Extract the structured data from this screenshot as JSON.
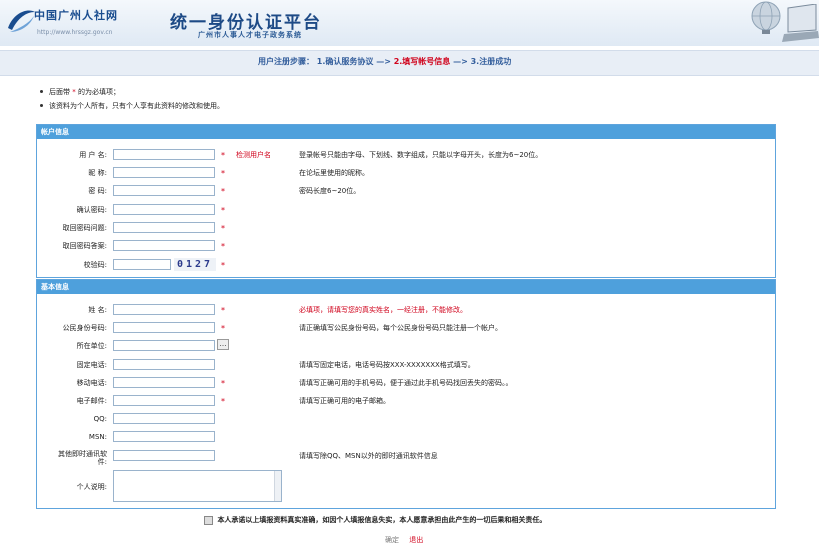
{
  "header": {
    "logo_title": "中国广州人社网",
    "logo_url": "http://www.hrssgz.gov.cn",
    "site_title": "统一身份认证平台",
    "site_subtitle": "广州市人事人才电子政务系统"
  },
  "steps": {
    "prefix": "用户注册步骤：",
    "step1": "1.确认服务协议",
    "arrow1": "—>",
    "step2": "2.填写帐号信息",
    "arrow2": "—>",
    "step3": "3.注册成功"
  },
  "notes": {
    "note1_a": "后面带",
    "note1_star": "*",
    "note1_b": "的为必填项；",
    "note2": "该资料为个人所有，只有个人享有此资料的修改和使用。"
  },
  "account": {
    "title": "帐户信息",
    "username_label": "用 户 名:",
    "check_username": "检测用户名",
    "username_hint": "登录帐号只能由字母、下划线、数字组成，只能以字母开头，长度为6~20位。",
    "nickname_label": "昵    称:",
    "nickname_hint": "在论坛里使用的昵称。",
    "password_label": "密    码:",
    "password_hint": "密码长度6~20位。",
    "confirm_label": "确认密码:",
    "question_label": "取回密码问题:",
    "answer_label": "取回密码答案:",
    "captcha_label": "校验码:",
    "captcha_value": "0127"
  },
  "basic": {
    "title": "基本信息",
    "name_label": "姓    名:",
    "name_hint": "必填项，请填写您的真实姓名，一经注册，不能修改。",
    "id_label": "公民身份号码:",
    "id_hint": "请正确填写公民身份号码，每个公民身份号码只能注册一个帐户。",
    "unit_label": "所在单位:",
    "browse_label": "…",
    "phone_label": "固定电话:",
    "phone_hint": "请填写固定电话，电话号码按XXX-XXXXXXX格式填写。",
    "mobile_label": "移动电话:",
    "mobile_hint": "请填写正确可用的手机号码，便于通过此手机号码找回丢失的密码。。",
    "email_label": "电子邮件:",
    "email_hint": "请填写正确可用的电子邮箱。",
    "qq_label": "QQ:",
    "msn_label": "MSN:",
    "im_label_1": "其他即时通讯软",
    "im_label_2": "件:",
    "im_hint": "请填写除QQ、MSN以外的即时通讯软件信息",
    "bio_label": "个人说明:"
  },
  "footer": {
    "agree_text": "本人承诺以上填报资料真实准确，如因个人填报信息失实，本人愿意承担由此产生的一切后果和相关责任。",
    "ok_label": "确定",
    "exit_label": "退出"
  },
  "colors": {
    "accent": "#4ea0dc",
    "required": "#d0021b",
    "title_blue": "#1d4a86"
  },
  "req_mark": "*"
}
